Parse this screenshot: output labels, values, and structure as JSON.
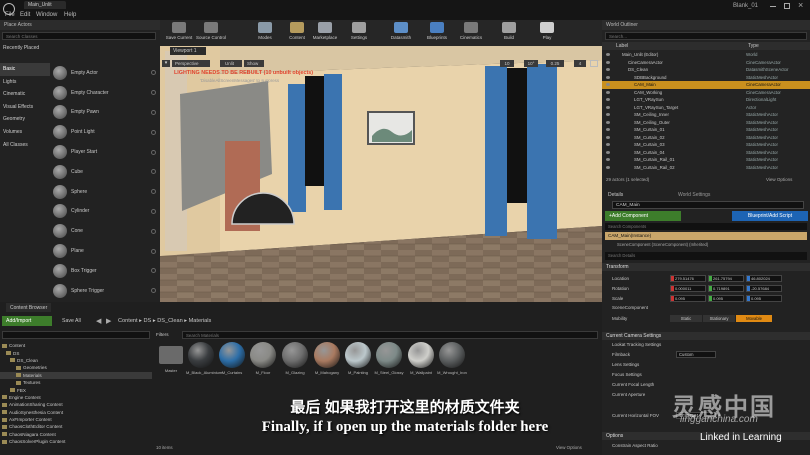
{
  "titlebar": {
    "tab": "Main_Unlit",
    "project": "Blank_01"
  },
  "menu": [
    "File",
    "Edit",
    "Window",
    "Help"
  ],
  "toolbar": [
    {
      "label": "Save Current",
      "icon": "save-icon"
    },
    {
      "label": "Source Control",
      "icon": "source-control-icon"
    },
    {
      "label": "Modes",
      "icon": "modes-icon"
    },
    {
      "label": "Content",
      "icon": "content-icon"
    },
    {
      "label": "Marketplace",
      "icon": "marketplace-icon"
    },
    {
      "label": "Settings",
      "icon": "settings-icon"
    },
    {
      "label": "Datasmith",
      "icon": "datasmith-icon"
    },
    {
      "label": "Blueprints",
      "icon": "blueprints-icon"
    },
    {
      "label": "Cinematics",
      "icon": "cinematics-icon"
    },
    {
      "label": "Build",
      "icon": "build-icon"
    },
    {
      "label": "Play",
      "icon": "play-icon"
    }
  ],
  "place_actors": {
    "tab": "Place Actors",
    "search_placeholder": "Search Classes",
    "recent": "Recently Placed",
    "categories": [
      "Basic",
      "Lights",
      "Cinematic",
      "Visual Effects",
      "Geometry",
      "Volumes",
      "All Classes"
    ],
    "actors": [
      "Empty Actor",
      "Empty Character",
      "Empty Pawn",
      "Point Light",
      "Player Start",
      "Cube",
      "Sphere",
      "Cylinder",
      "Cone",
      "Plane",
      "Box Trigger",
      "Sphere Trigger"
    ]
  },
  "viewport": {
    "tab": "Viewport 1",
    "perspective": "Perspective",
    "lit": "Unlit",
    "show": "Show",
    "warning": "LIGHTING NEEDS TO BE REBUILT (10 unbuilt objects)",
    "warning2": "'DisableAllScreenMessages' to suppress",
    "snap_grid": "10",
    "snap_angle": "10°",
    "snap_scale": "0.25",
    "camera_speed": "4"
  },
  "outliner": {
    "tab": "World Outliner",
    "search_placeholder": "Search...",
    "col_label": "Label",
    "col_type": "Type",
    "rows": [
      {
        "label": "Main_Unlit (Editor)",
        "type": "World"
      },
      {
        "label": "CineCameraActor",
        "type": "CineCameraActor"
      },
      {
        "label": "DS_Clean",
        "type": "DatasmithSceneActor"
      },
      {
        "label": "SDBBackground",
        "type": "StaticMeshActor"
      },
      {
        "label": "CAM_Main",
        "type": "CineCameraActor",
        "selected": true
      },
      {
        "label": "CAM_Working",
        "type": "CineCameraActor"
      },
      {
        "label": "LGT_VRaySun",
        "type": "DirectionalLight"
      },
      {
        "label": "LGT_VRaySun_Target",
        "type": "Actor"
      },
      {
        "label": "SM_Ceiling_Inner",
        "type": "StaticMeshActor"
      },
      {
        "label": "SM_Ceiling_Outer",
        "type": "StaticMeshActor"
      },
      {
        "label": "SM_Curtain_01",
        "type": "StaticMeshActor"
      },
      {
        "label": "SM_Curtain_02",
        "type": "StaticMeshActor"
      },
      {
        "label": "SM_Curtain_03",
        "type": "StaticMeshActor"
      },
      {
        "label": "SM_Curtain_04",
        "type": "StaticMeshActor"
      },
      {
        "label": "SM_Curtain_Rail_01",
        "type": "StaticMeshActor"
      },
      {
        "label": "SM_Curtain_Rail_02",
        "type": "StaticMeshActor"
      }
    ],
    "footer": "29 actors (1 selected)",
    "view_options": "View Options"
  },
  "details": {
    "tab": "Details",
    "tab2": "World Settings",
    "name": "CAM_Main",
    "add_component": "+Add Component",
    "blueprint": "Blueprint/Add Script",
    "search_components": "Search Components",
    "instance": "CAM_Main(Instance)",
    "scene_component": "SceneComponent (SceneComponent) (Inherited)",
    "search_details": "Search Details",
    "transform": "Transform",
    "location_label": "Location",
    "location": [
      "279.51476",
      "261.75794",
      "46.802024"
    ],
    "rotation_label": "Rotation",
    "rotation": [
      "0.000011",
      "0.719891",
      "-20.57684"
    ],
    "scale_label": "Scale",
    "scale": [
      "0.095",
      "0.095",
      "0.095"
    ],
    "scene_comp": "SceneComponent",
    "mobility": "Mobility",
    "mobility_opts": [
      "Static",
      "Stationary",
      "Movable"
    ],
    "current_camera": "Current Camera Settings",
    "lookat": "Lookat Tracking Settings",
    "filmback": "Filmback",
    "filmback_val": "Custom",
    "lens_settings": "Lens Settings",
    "focus_settings": "Focus Settings",
    "current_focal": "Current Focal Length",
    "current_aperture": "Current Aperture",
    "current_fov": "Current Horizontal FOV",
    "options": "Options",
    "constrain": "Constrain Aspect Ratio",
    "fov_val": "17.857191"
  },
  "content_browser": {
    "tab": "Content Browser",
    "add_import": "Add/Import",
    "save_all": "Save All",
    "breadcrumb": [
      "Content",
      "DS",
      "DS_Clean",
      "Materials"
    ],
    "filters": "Filters",
    "search_placeholder": "Search Materials",
    "tree": [
      "Content",
      "DS",
      "DS_Clean",
      "Geometries",
      "Materials",
      "Textures",
      "FBX",
      "Engine Content",
      "AnimationSharing Content",
      "AudioSynesthesia Content",
      "AxFImporter Content",
      "ChaosClothEditor Content",
      "ChaosNiagara Content",
      "ChaosSolverPlugin Content"
    ],
    "items": [
      "Master",
      "M_Black_Aluminium",
      "M_Curtains",
      "M_Floor",
      "M_Glazing",
      "M_Mahogany",
      "M_Painting",
      "M_Steel_Glossy",
      "M_Wallpaint",
      "M_Wrought_Iron"
    ],
    "item_colors": [
      "#555555",
      "#3a3d40",
      "#2c6ea8",
      "#8a8a86",
      "#6e6e6e",
      "#a97a60",
      "#bcc8cc",
      "#7d8a88",
      "#cfcfcb",
      "#5c5f60"
    ],
    "count": "10 items",
    "view_options": "View Options"
  },
  "subtitle": {
    "cn": "最后 如果我打开这里的材质文件夹",
    "en": "Finally, if I open up the materials folder here"
  },
  "watermark": {
    "site": "lingganchina.com",
    "brand": "灵感中国",
    "linkedin": "Linked in Learning"
  }
}
